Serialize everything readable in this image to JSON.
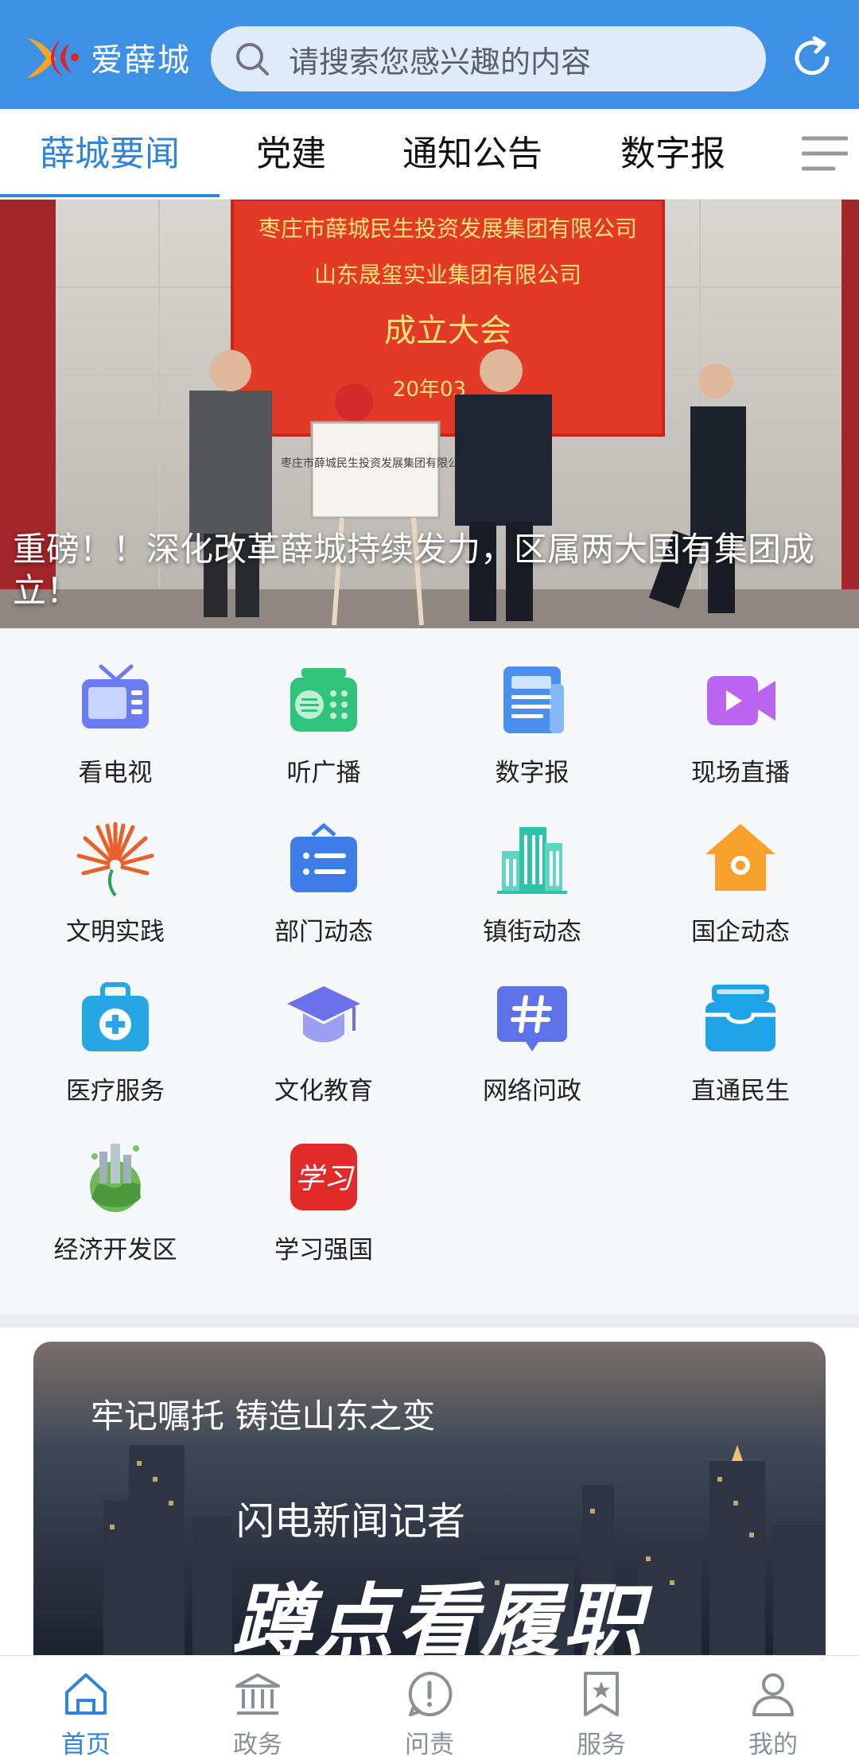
{
  "header": {
    "logo_text": "爱薛城",
    "search_placeholder": "请搜索您感兴趣的内容",
    "accent": "#3e8fe6"
  },
  "tabs": [
    {
      "label": "薛城要闻",
      "active": true
    },
    {
      "label": "党建",
      "active": false
    },
    {
      "label": "通知公告",
      "active": false
    },
    {
      "label": "数字报",
      "active": false
    }
  ],
  "banner": {
    "title": "重磅！！深化改革薛城持续发力，区属两大国有集团成立！",
    "screen_line1": "枣庄市薛城民生投资发展集团有限公司",
    "screen_line2": "山东晟玺实业集团有限公司",
    "screen_line3": "成立大会",
    "screen_date": "20年03",
    "plaque_text": "枣庄市薛城民生投资发展集团有限公司"
  },
  "grid": [
    {
      "label": "看电视",
      "icon": "tv-icon"
    },
    {
      "label": "听广播",
      "icon": "radio-icon"
    },
    {
      "label": "数字报",
      "icon": "newspaper-icon"
    },
    {
      "label": "现场直播",
      "icon": "video-icon"
    },
    {
      "label": "文明实践",
      "icon": "flower-icon"
    },
    {
      "label": "部门动态",
      "icon": "briefcase-icon"
    },
    {
      "label": "镇街动态",
      "icon": "buildings-icon"
    },
    {
      "label": "国企动态",
      "icon": "house-icon"
    },
    {
      "label": "医疗服务",
      "icon": "medical-kit-icon"
    },
    {
      "label": "文化教育",
      "icon": "graduation-cap-icon"
    },
    {
      "label": "网络问政",
      "icon": "hashtag-icon"
    },
    {
      "label": "直通民生",
      "icon": "inbox-icon"
    },
    {
      "label": "经济开发区",
      "icon": "eco-city-icon"
    },
    {
      "label": "学习强国",
      "icon": "xuexi-icon",
      "icon_text": "学习"
    }
  ],
  "feature": {
    "top_text": "牢记嘱托 铸造山东之变",
    "mid_text": "闪电新闻记者",
    "big_text": "蹲点看履职"
  },
  "bottom_nav": [
    {
      "label": "首页",
      "icon": "home-icon",
      "active": true
    },
    {
      "label": "政务",
      "icon": "government-icon",
      "active": false
    },
    {
      "label": "问责",
      "icon": "alert-icon",
      "active": false
    },
    {
      "label": "服务",
      "icon": "bookmark-star-icon",
      "active": false
    },
    {
      "label": "我的",
      "icon": "user-icon",
      "active": false
    }
  ]
}
